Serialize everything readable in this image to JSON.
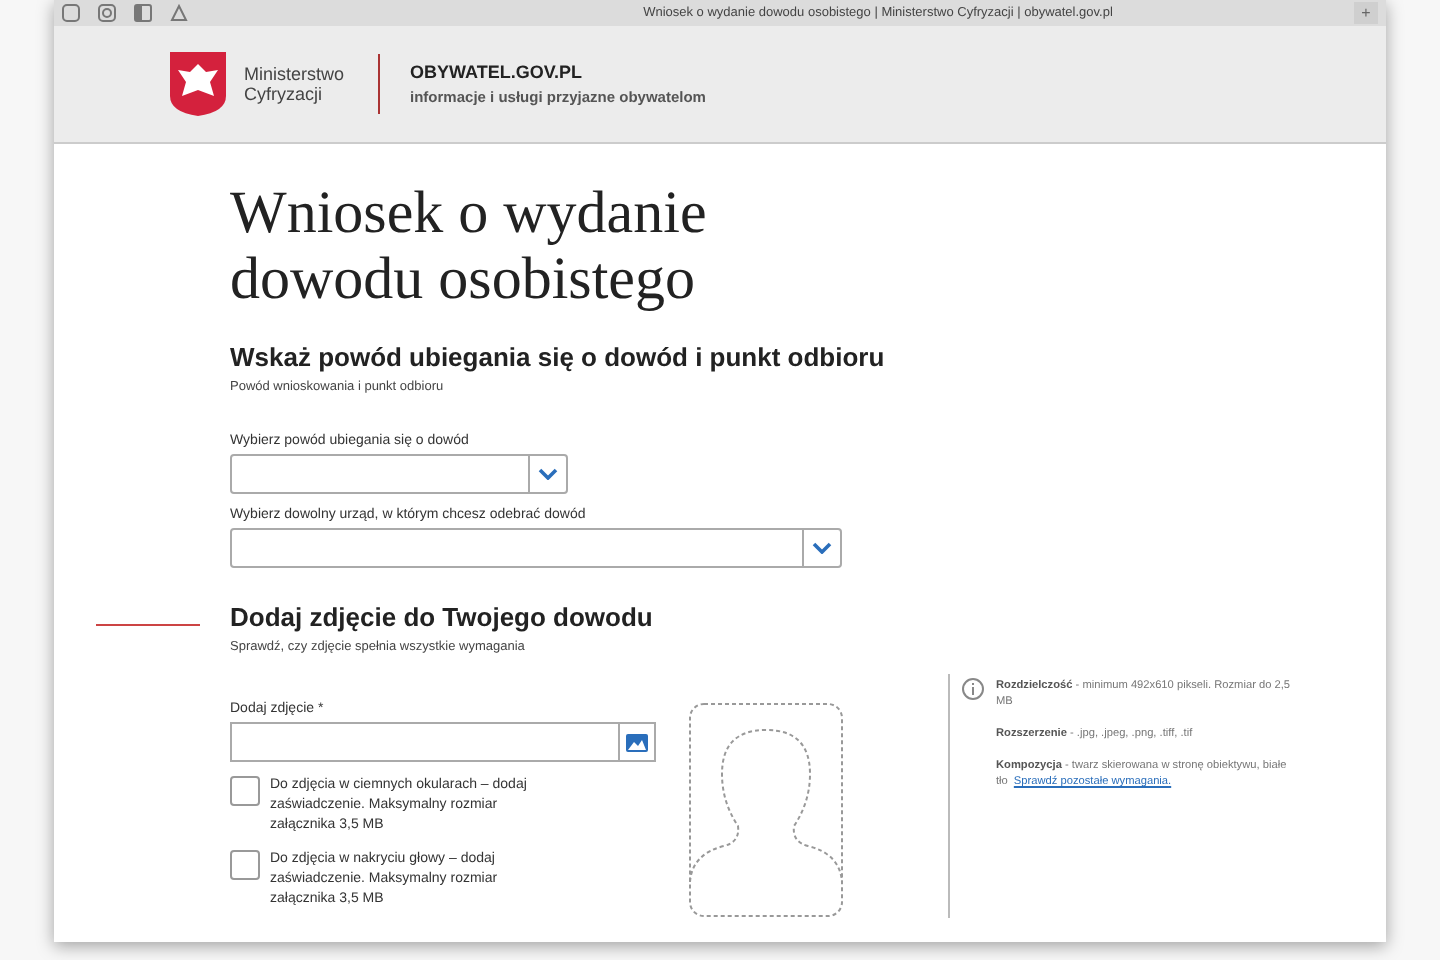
{
  "browser": {
    "tab_title": "Wniosek o wydanie dowodu osobistego | Ministerstwo Cyfryzacji | obywatel.gov.pl",
    "new_tab": "+"
  },
  "header": {
    "ministry_lines": [
      "Ministerstwo",
      "Cyfryzacji"
    ],
    "site_name": "OBYWATEL.GOV.PL",
    "site_tagline": "informacje i usługi przyjazne obywatelom"
  },
  "page_title": "Wniosek o wydanie dowodu osobistego",
  "section_reason": {
    "heading": "Wskaż powód ubiegania się o dowód i punkt odbioru",
    "subheading": "Powód wnioskowania i punkt odbioru",
    "selects": [
      {
        "label": "Wybierz powód ubiegania się o dowód",
        "wide": false
      },
      {
        "label": "Wybierz dowolny urząd, w którym chcesz odebrać dowód",
        "wide": true
      }
    ]
  },
  "section_photo": {
    "heading": "Dodaj zdjęcie do Twojego dowodu",
    "subheading": "Sprawdź, czy zdjęcie spełnia wszystkie wymagania",
    "field_label": "Dodaj zdjęcie *",
    "checkboxes": [
      {
        "label": "Do zdjęcia w ciemnych okularach – dodaj zaświadczenie. Maksymalny rozmiar załącznika 3,5 MB",
        "checked": false
      },
      {
        "label": "Do zdjęcia w nakryciu głowy – dodaj zaświadczenie. Maksymalny rozmiar załącznika 3,5 MB",
        "checked": false
      }
    ],
    "requirements": [
      {
        "text": "**Rozdzielczość** - minimum 492x610 pikseli. Rozmiar do 2,5 MB"
      },
      {
        "text": "**Rozszerzenie** - .jpg, .jpeg, .png, .tiff, .tif"
      },
      {
        "text": "**Kompozycja** - twarz skierowana w stronę obiektywu, białe tło",
        "link": "Sprawdź pozostałe wymagania."
      }
    ]
  }
}
